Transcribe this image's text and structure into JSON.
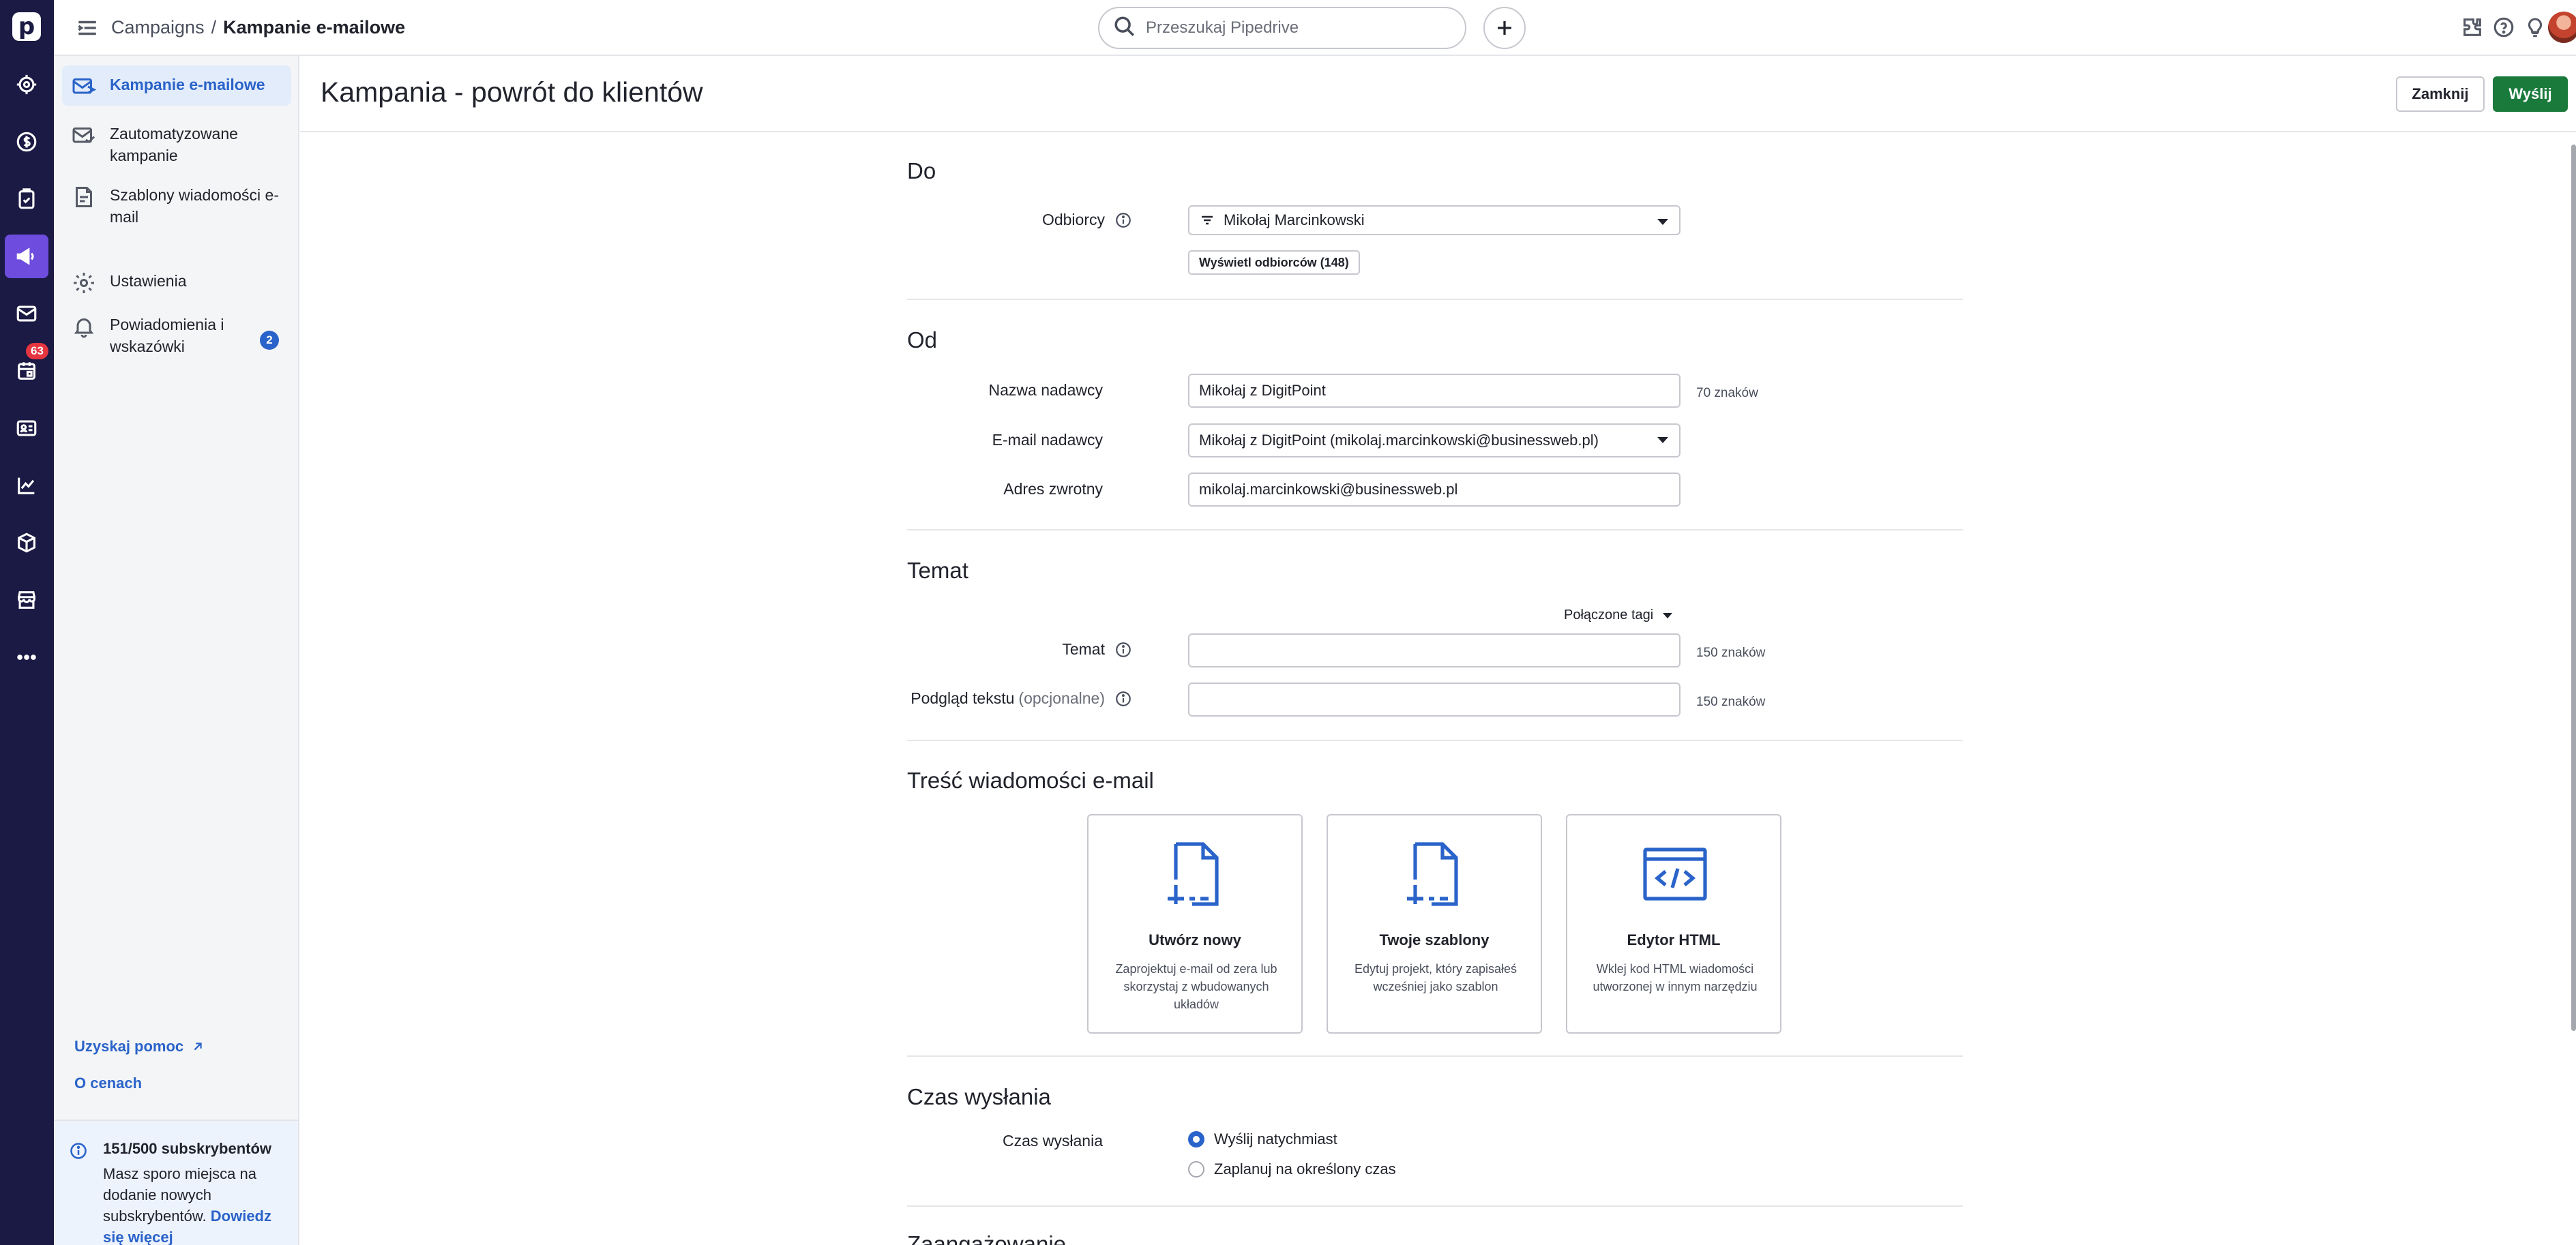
{
  "app": {
    "logo": "p"
  },
  "rail": {
    "badge": "63",
    "icons": [
      "radar-icon",
      "dollar-icon",
      "checklist-icon",
      "megaphone-icon",
      "mail-icon",
      "calendar-icon",
      "contact-card-icon",
      "chart-icon",
      "box-icon",
      "store-icon",
      "more-icon"
    ]
  },
  "topbar": {
    "breadcrumb_parent": "Campaigns",
    "breadcrumb_sep": "/",
    "breadcrumb_current": "Kampanie e-mailowe",
    "search_placeholder": "Przeszukaj Pipedrive"
  },
  "sidebar": {
    "items": [
      {
        "label": "Kampanie e-mailowe"
      },
      {
        "label": "Zautomatyzowane kampanie"
      },
      {
        "label": "Szablony wiadomości e-mail"
      },
      {
        "label": "Ustawienia"
      },
      {
        "label": "Powiadomienia i wskazówki",
        "badge": "2"
      }
    ],
    "help_link": "Uzyskaj pomoc",
    "pricing_link": "O cenach",
    "subscribers": {
      "title": "151/500 subskrybentów",
      "text": "Masz sporo miejsca na dodanie nowych subskrybentów.",
      "more_link": "Dowiedz się więcej"
    }
  },
  "page": {
    "title": "Kampania - powrót do klientów",
    "close_label": "Zamknij",
    "send_label": "Wyślij"
  },
  "to": {
    "section": "Do",
    "recipients_label": "Odbiorcy",
    "recipients_value": "Mikołaj Marcinkowski",
    "show_recipients": "Wyświetl odbiorców (148)"
  },
  "from": {
    "section": "Od",
    "sender_name_label": "Nazwa nadawcy",
    "sender_name_value": "Mikołaj z DigitPoint",
    "sender_name_count": "70 znaków",
    "sender_email_label": "E-mail nadawcy",
    "sender_email_value": "Mikołaj z DigitPoint (mikolaj.marcinkowski@businessweb.pl)",
    "reply_label": "Adres zwrotny",
    "reply_value": "mikolaj.marcinkowski@businessweb.pl"
  },
  "subject": {
    "section": "Temat",
    "tags_dropdown": "Połączone tagi",
    "subject_label": "Temat",
    "subject_value": "",
    "subject_count": "150 znaków",
    "preview_label": "Podgląd tekstu",
    "preview_optional": "(opcjonalne)",
    "preview_value": "",
    "preview_count": "150 znaków"
  },
  "content": {
    "section": "Treść wiadomości e-mail",
    "cards": [
      {
        "title": "Utwórz nowy",
        "desc": "Zaprojektuj e-mail od zera lub skorzystaj z wbudowanych układów"
      },
      {
        "title": "Twoje szablony",
        "desc": "Edytuj projekt, który zapisałeś wcześniej jako szablon"
      },
      {
        "title": "Edytor HTML",
        "desc": "Wklej kod HTML wiadomości utworzonej w innym narzędziu"
      }
    ]
  },
  "schedule": {
    "section": "Czas wysłania",
    "label": "Czas wysłania",
    "options": [
      {
        "label": "Wyślij natychmiast",
        "selected": true
      },
      {
        "label": "Zaplanuj na określony czas",
        "selected": false
      }
    ],
    "next_section": "Zaangażowanie"
  }
}
